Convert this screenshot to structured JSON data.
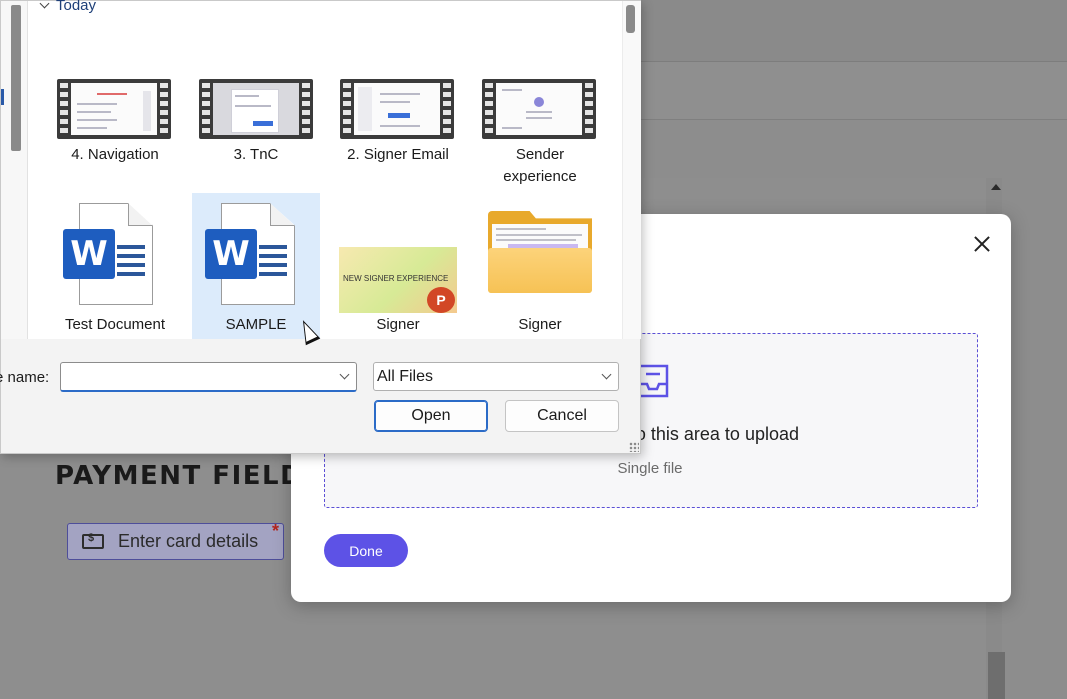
{
  "background_page": {
    "heading": "PAYMENT FIELD",
    "card_field_label": "Enter card details",
    "required_marker": "*"
  },
  "upload_modal": {
    "drop_text": "Drag and drop files to this area to upload",
    "drop_text_visible": "o this area to upload",
    "subtext": "Single file",
    "done_label": "Done",
    "accent_color": "#5d52e6"
  },
  "file_dialog": {
    "group_label": "Today",
    "items": [
      {
        "label": "4. Navigation",
        "type": "video"
      },
      {
        "label": "3. TnC",
        "type": "video"
      },
      {
        "label": "2. Signer Email",
        "type": "video"
      },
      {
        "label": "Sender experience",
        "type": "video"
      },
      {
        "label": "Test Document",
        "type": "word"
      },
      {
        "label": "SAMPLE",
        "type": "word",
        "selected": true
      },
      {
        "label": "Signer",
        "type": "powerpoint",
        "thumb_text": "NEW SIGNER EXPERIENCE"
      },
      {
        "label": "Signer",
        "type": "folder"
      }
    ],
    "filename_label": "e name:",
    "filename_value": "",
    "filetype_value": "All Files",
    "open_label": "Open",
    "cancel_label": "Cancel"
  },
  "icons": {
    "word_badge": "W",
    "ppt_badge": "P"
  }
}
